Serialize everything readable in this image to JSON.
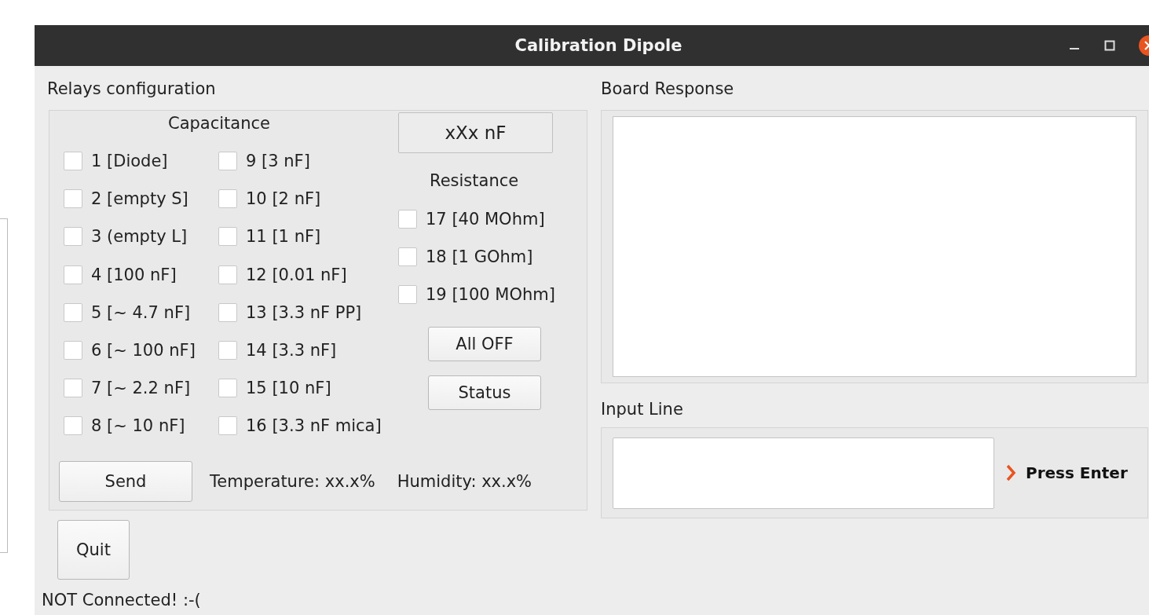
{
  "window": {
    "title": "Calibration Dipole"
  },
  "relays_configuration": {
    "label": "Relays configuration",
    "capacitance": {
      "heading": "Capacitance",
      "relays": [
        {
          "label": "1 [Diode]",
          "checked": false
        },
        {
          "label": "2 [empty S]",
          "checked": false
        },
        {
          "label": "3 (empty L]",
          "checked": false
        },
        {
          "label": "4 [100 nF]",
          "checked": false
        },
        {
          "label": "5 [~ 4.7 nF]",
          "checked": false
        },
        {
          "label": "6 [~ 100 nF]",
          "checked": false
        },
        {
          "label": "7 [~ 2.2 nF]",
          "checked": false
        },
        {
          "label": "8 [~ 10 nF]",
          "checked": false
        },
        {
          "label": "9 [3 nF]",
          "checked": false
        },
        {
          "label": "10 [2 nF]",
          "checked": false
        },
        {
          "label": "11 [1 nF]",
          "checked": false
        },
        {
          "label": "12 [0.01 nF]",
          "checked": false
        },
        {
          "label": "13 [3.3 nF PP]",
          "checked": false
        },
        {
          "label": "14 [3.3 nF]",
          "checked": false
        },
        {
          "label": "15 [10 nF]",
          "checked": false
        },
        {
          "label": "16 [3.3 nF mica]",
          "checked": false
        }
      ]
    },
    "value_display": "xXx nF",
    "resistance": {
      "heading": "Resistance",
      "relays": [
        {
          "label": "17 [40 MOhm]",
          "checked": false
        },
        {
          "label": "18 [1 GOhm]",
          "checked": false
        },
        {
          "label": "19 [100 MOhm]",
          "checked": false
        }
      ]
    },
    "buttons": [
      "All OFF",
      "Status"
    ],
    "send_button": "Send",
    "temperature": "Temperature: xx.x%",
    "humidity": "Humidity: xx.x%"
  },
  "board_response": {
    "label": "Board Response"
  },
  "input_line": {
    "label": "Input Line",
    "hint": "Press Enter"
  },
  "quit_button": "Quit",
  "status": "NOT Connected! :-("
}
